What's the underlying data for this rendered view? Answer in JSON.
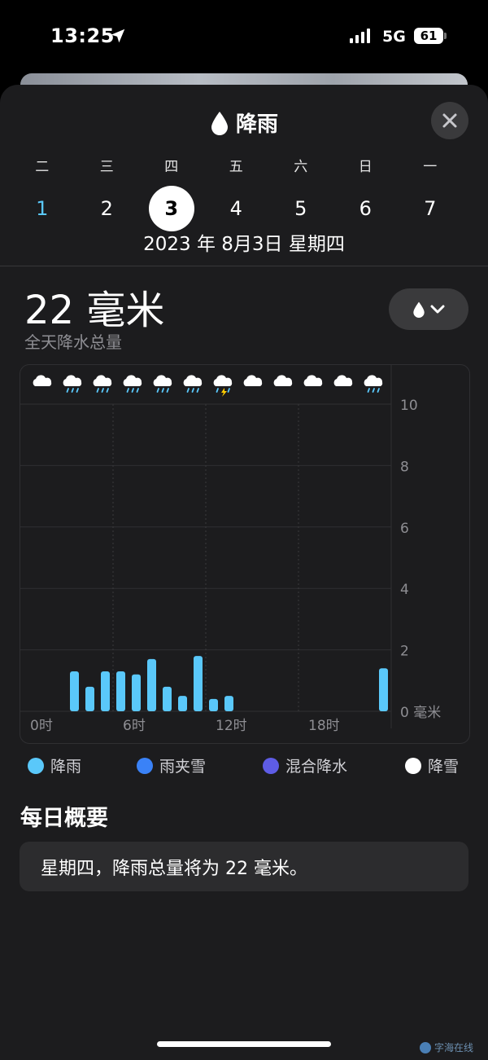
{
  "status_bar": {
    "time": "13:25",
    "network": "5G",
    "battery": "61"
  },
  "sheet": {
    "title": "降雨",
    "close_icon": "xmark-icon",
    "weekdays": [
      "二",
      "三",
      "四",
      "五",
      "六",
      "日",
      "一"
    ],
    "dates": [
      "1",
      "2",
      "3",
      "4",
      "5",
      "6",
      "7"
    ],
    "selected_index": 2,
    "full_date": "2023 年 8月3日 星期四",
    "amount": "22 毫米",
    "amount_label": "全天降水总量",
    "type_toggle_icon": "raindrop-icon"
  },
  "chart_data": {
    "type": "bar",
    "x_tick_labels": [
      "0时",
      "6时",
      "12时",
      "18时"
    ],
    "y_tick_labels": [
      "10",
      "8",
      "6",
      "4",
      "2",
      "0 毫米"
    ],
    "ylim": [
      0,
      10
    ],
    "hours": [
      0,
      1,
      2,
      3,
      4,
      5,
      6,
      7,
      8,
      9,
      10,
      11,
      12,
      13,
      14,
      15,
      16,
      17,
      18,
      19,
      20,
      21,
      22,
      23
    ],
    "values": [
      0,
      0,
      0,
      1.3,
      0.8,
      1.3,
      1.3,
      1.2,
      1.7,
      0.8,
      0.5,
      1.8,
      0.4,
      0.5,
      0,
      0,
      0,
      0,
      0,
      0,
      0,
      0,
      0,
      1.4
    ],
    "bar_color": "#5ac8fa",
    "weather_icons": [
      "cloud-icon",
      "cloud-drizzle-icon",
      "cloud-drizzle-icon",
      "cloud-drizzle-icon",
      "cloud-drizzle-icon",
      "cloud-drizzle-icon",
      "cloud-bolt-rain-icon",
      "cloud-icon",
      "cloud-icon",
      "cloud-icon",
      "cloud-icon",
      "cloud-drizzle-icon"
    ],
    "grid": true
  },
  "legend": [
    {
      "label": "降雨",
      "color": "#5ac8fa"
    },
    {
      "label": "雨夹雪",
      "color": "#3a82f7"
    },
    {
      "label": "混合降水",
      "color": "#5e5ce6"
    },
    {
      "label": "降雪",
      "color": "#ffffff"
    }
  ],
  "summary": {
    "heading": "每日概要",
    "text": "星期四，降雨总量将为 22 毫米。"
  },
  "watermark": "字海在线"
}
